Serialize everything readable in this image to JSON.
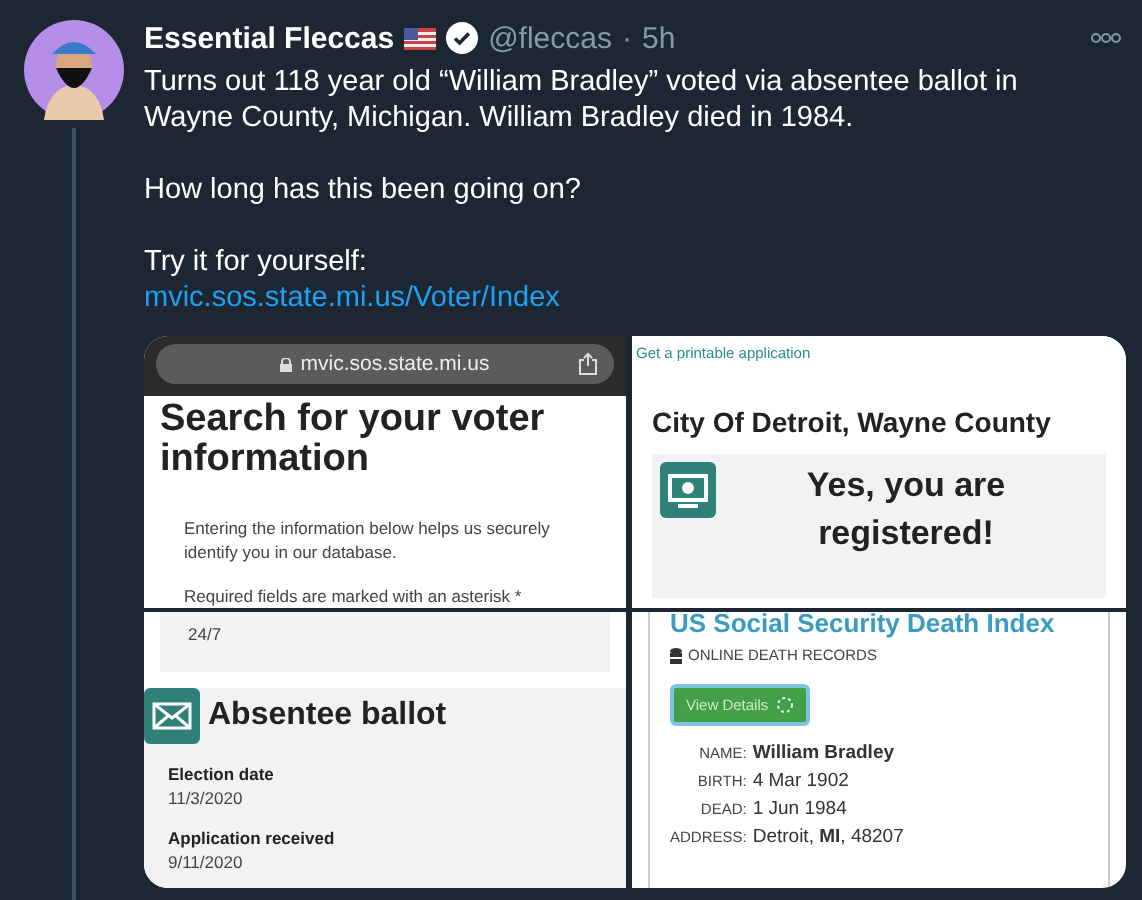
{
  "tweet": {
    "author": {
      "name": "Essential Fleccas",
      "verified": true,
      "handle": "@fleccas",
      "separator": "·",
      "time": "5h"
    },
    "paragraphs": [
      [
        "Turns out 118 year old “William Bradley” voted via absentee ballot in Wayne County, Michigan. William Bradley died in 1984."
      ],
      [
        "How long has this been going on?"
      ],
      [
        "Try it for yourself:"
      ]
    ],
    "link": "mvic.sos.state.mi.us/Voter/Index"
  },
  "media": {
    "left_top": {
      "url": "mvic.sos.state.mi.us",
      "heading": "Search for your voter information",
      "intro": "Entering the information below helps us securely identify you in our database.",
      "required_note": "Required fields are marked with an asterisk",
      "asterisk": "*"
    },
    "left_bottom": {
      "hours": "24/7",
      "card_title": "Absentee ballot",
      "fields": [
        {
          "label": "Election date",
          "value": "11/3/2020"
        },
        {
          "label": "Application received",
          "value": "9/11/2020"
        }
      ]
    },
    "right_top": {
      "top_link": "Get a printable application",
      "heading": "City Of Detroit, Wayne County",
      "status": "Yes, you are registered!"
    },
    "right_bottom": {
      "title": "US Social Security Death Index",
      "subtitle": "ONLINE DEATH RECORDS",
      "button": "View Details",
      "records": [
        {
          "label": "NAME:",
          "value": "William Bradley",
          "bold": true
        },
        {
          "label": "BIRTH:",
          "value": "4 Mar 1902",
          "bold": false
        },
        {
          "label": "DEAD:",
          "value": "1 Jun 1984",
          "bold": false
        },
        {
          "label": "ADDRESS:",
          "value": "Detroit, **MI**, 48207",
          "bold": false
        }
      ]
    }
  }
}
